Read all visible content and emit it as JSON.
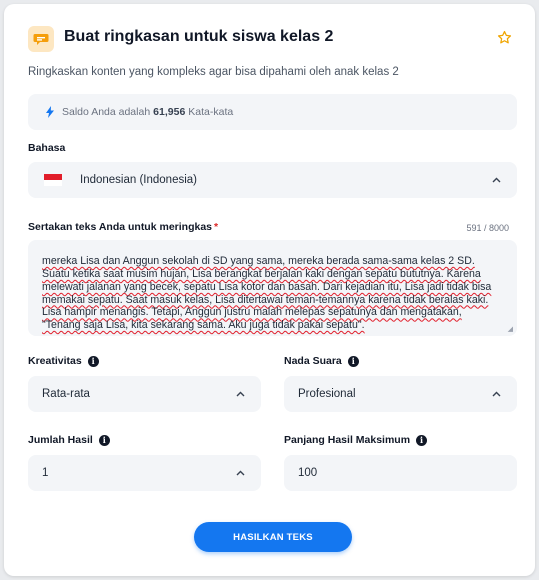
{
  "header": {
    "title": "Buat ringkasan untuk siswa kelas 2",
    "subtitle": "Ringkaskan konten yang kompleks agar bisa dipahami oleh anak kelas 2"
  },
  "balance": {
    "prefix": "Saldo Anda adalah",
    "amount": "61,956",
    "suffix": "Kata-kata"
  },
  "language": {
    "label": "Bahasa",
    "value": "Indonesian (Indonesia)"
  },
  "content": {
    "label": "Sertakan teks Anda untuk meringkas",
    "required_mark": "*",
    "counter": "591 / 8000",
    "text": "mereka Lisa dan Anggun sekolah di SD yang sama, mereka berada sama-sama kelas 2 SD. Suatu ketika saat musim hujan, Lisa berangkat berjalan kaki dengan sepatu bututnya. Karena melewati jalanan yang becek, sepatu Lisa kotor dan basah. Dari kejadian itu, Lisa jadi tidak bisa memakai sepatu. Saat masuk kelas, Lisa ditertawai teman-temannya karena tidak beralas kaki. Lisa hampir menangis. Tetapi, Anggun justru malah melepas sepatunya dan mengatakan, \"Tenang saja Lisa, kita sekarang sama. Aku juga tidak pakai sepatu\"."
  },
  "creativity": {
    "label": "Kreativitas",
    "value": "Rata-rata"
  },
  "tone": {
    "label": "Nada Suara",
    "value": "Profesional"
  },
  "results": {
    "label": "Jumlah Hasil",
    "value": "1"
  },
  "max_length": {
    "label": "Panjang Hasil Maksimum",
    "value": "100"
  },
  "actions": {
    "generate_label": "HASILKAN TEKS"
  },
  "colors": {
    "accent": "#1477f0",
    "icon_bg": "#fde7c2",
    "star": "#f0a500",
    "required": "#dc2626"
  },
  "icons": {
    "header": "chat-bubble-icon",
    "favorite": "star-icon",
    "balance": "lightning-icon",
    "info": "info-icon",
    "dropdown": "chevron-up-icon"
  }
}
